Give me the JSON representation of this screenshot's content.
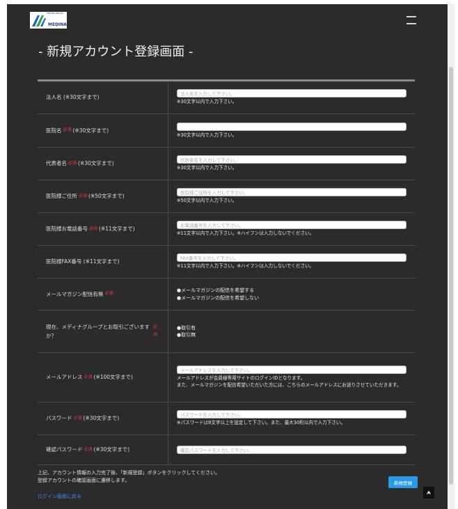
{
  "logo": {
    "name": "MEDINA",
    "sub": "MEDINA GROUP"
  },
  "page_title": "- 新規アカウント登録画面 -",
  "required_tag": "必須",
  "fields": [
    {
      "label": "法人名",
      "required": false,
      "limit": "(※30文字まで)",
      "placeholder": "法人名を入力して下さい。",
      "value": "",
      "note": "※30文字以内で入力下さい。"
    },
    {
      "label": "医院名",
      "required": true,
      "limit": "(※30文字まで)",
      "placeholder": "",
      "value": "",
      "note": "※30文字以内で入力下さい。"
    },
    {
      "label": "代表者名",
      "required": true,
      "limit": "(※30文字まで)",
      "placeholder": "代表者名を入力して下さい。",
      "value": "",
      "note": "※30文字以内で入力下さい。"
    },
    {
      "label": "医院様ご住所",
      "required": true,
      "limit": "(※50文字まで)",
      "placeholder": "医院様ご住所を入力して下さい。",
      "value": "",
      "note": "※50文字以内で入力下さい。"
    },
    {
      "label": "医院様お電話番号",
      "required": true,
      "limit": "(※11文字まで)",
      "placeholder": "お電話番号を入力して下さい。",
      "value": "",
      "note": "※11文字以内で入力下さい。※ハイフンは入力しないでください。"
    },
    {
      "label": "医院様FAX番号",
      "required": false,
      "limit": "(※11文字まで)",
      "placeholder": "FAX番号を入力して下さい。",
      "value": "",
      "note": "※11文字以内で入力下さい。※ハイフンは入力しないでください。"
    }
  ],
  "magazine": {
    "label": "メールマガジン配信有無",
    "options": [
      "●メールマガジンの配信を希望する",
      "●メールマガジンの配信を希望しない"
    ]
  },
  "group": {
    "label": "現在、メディナグループとお取引ございますか？",
    "options": [
      "●取引有",
      "●取引無"
    ]
  },
  "email": {
    "label": "メールアドレス",
    "limit": "(※100文字まで)",
    "placeholder": "メールアドレスを入力して下さい。",
    "note1": "メールアドレスが会員様専用サイトのログインIDとなります。",
    "note2": "また、メールマガジンを配信希望いただいた方には、こちらのメールアドレスにお送りさせていただきます。"
  },
  "password": {
    "label": "パスワード",
    "limit": "(※30文字まで)",
    "placeholder": "パスワードを入力して下さい。",
    "note": "※パスワードは8文字以上を設定して下さい。また、最大30桁以内で入力下さい。"
  },
  "confirm": {
    "label": "確認パスワード",
    "limit": "(※30文字まで)",
    "placeholder": "確認パスワードを入力して下さい。"
  },
  "footer": {
    "line1": "上記、アカウント情報の入力完了後、「新規登録」ボタンをクリックしてください。",
    "line2": "登録アカウントの確認画面に遷移します。"
  },
  "login_link": "ログイン画面に戻る",
  "register_button": "新規登録",
  "top_button": "⮝",
  "colors": {
    "background": "#2b2b2b",
    "required": "#e03a3a",
    "accent": "#2a9ae6",
    "link": "#3e8ef5"
  }
}
